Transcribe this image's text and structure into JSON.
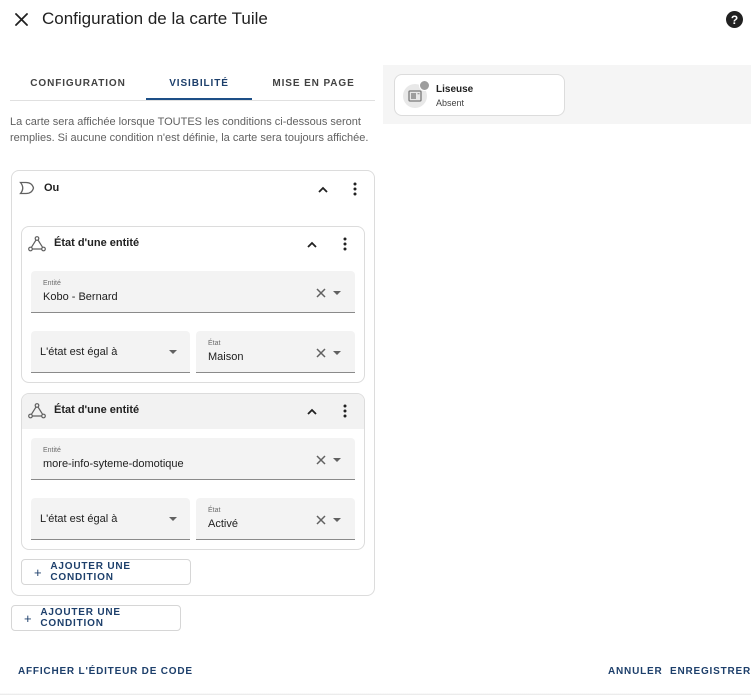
{
  "dialog": {
    "title": "Configuration de la carte Tuile"
  },
  "tabs": [
    {
      "label": "CONFIGURATION"
    },
    {
      "label": "VISIBILITÉ"
    },
    {
      "label": "MISE EN PAGE"
    }
  ],
  "active_tab": "VISIBILITÉ",
  "description": "La carte sera affichée lorsque TOUTES les conditions ci-dessous seront remplies. Si aucune condition n'est définie, la carte sera toujours affichée.",
  "or_block": {
    "title": "Ou",
    "conditions": [
      {
        "title": "État d'une entité",
        "entity_label": "Entité",
        "entity_value": "Kobo - Bernard",
        "operator": "L'état est égal à",
        "state_label": "État",
        "state_value": "Maison"
      },
      {
        "title": "État d'une entité",
        "entity_label": "Entité",
        "entity_value": "more-info-syteme-domotique",
        "operator": "L'état est égal à",
        "state_label": "État",
        "state_value": "Activé"
      }
    ],
    "add_label": "AJOUTER UNE CONDITION"
  },
  "add_condition_label": "AJOUTER UNE CONDITION",
  "preview": {
    "name": "Liseuse",
    "state": "Absent"
  },
  "footer": {
    "code_editor": "AFFICHER L'ÉDITEUR DE CODE",
    "cancel": "ANNULER",
    "save": "ENREGISTRER"
  },
  "colors": {
    "accent": "#1d3f6b",
    "tab_underline": "#1d4f87",
    "field_bg": "#f3f3f3"
  },
  "icons": {
    "close": "close-icon",
    "help": "help-circle-icon",
    "or": "gate-or-icon",
    "entity_state": "state-machine-icon",
    "collapse": "chevron-up-icon",
    "menu": "dots-vertical-icon",
    "clear": "close-icon",
    "dropdown": "menu-down-icon",
    "add": "plus-icon",
    "tile": "book-reader-icon"
  }
}
